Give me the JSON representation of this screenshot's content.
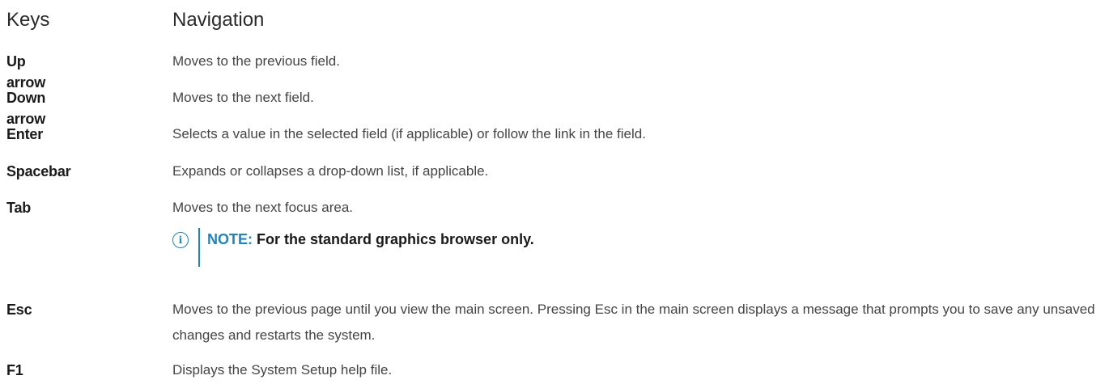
{
  "header": {
    "keys": "Keys",
    "navigation": "Navigation"
  },
  "rows": [
    {
      "key": "Up arrow",
      "desc": "Moves to the previous field."
    },
    {
      "key": "Down arrow",
      "desc": "Moves to the next field."
    },
    {
      "key": "Enter",
      "desc": "Selects a value in the selected field (if applicable) or follow the link in the field."
    },
    {
      "key": "Spacebar",
      "desc": "Expands or collapses a drop-down list, if applicable."
    },
    {
      "key": "Tab",
      "desc": "Moves to the next focus area."
    },
    {
      "key": "Esc",
      "desc": "Moves to the previous page until you view the main screen. Pressing Esc in the main screen displays a message that prompts you to save any unsaved changes and restarts the system."
    },
    {
      "key": "F1",
      "desc": "Displays the System Setup help file."
    }
  ],
  "note": {
    "icon": "info-icon",
    "label": "NOTE:",
    "text": "For the standard graphics browser only.",
    "color": "#1a86c8"
  }
}
